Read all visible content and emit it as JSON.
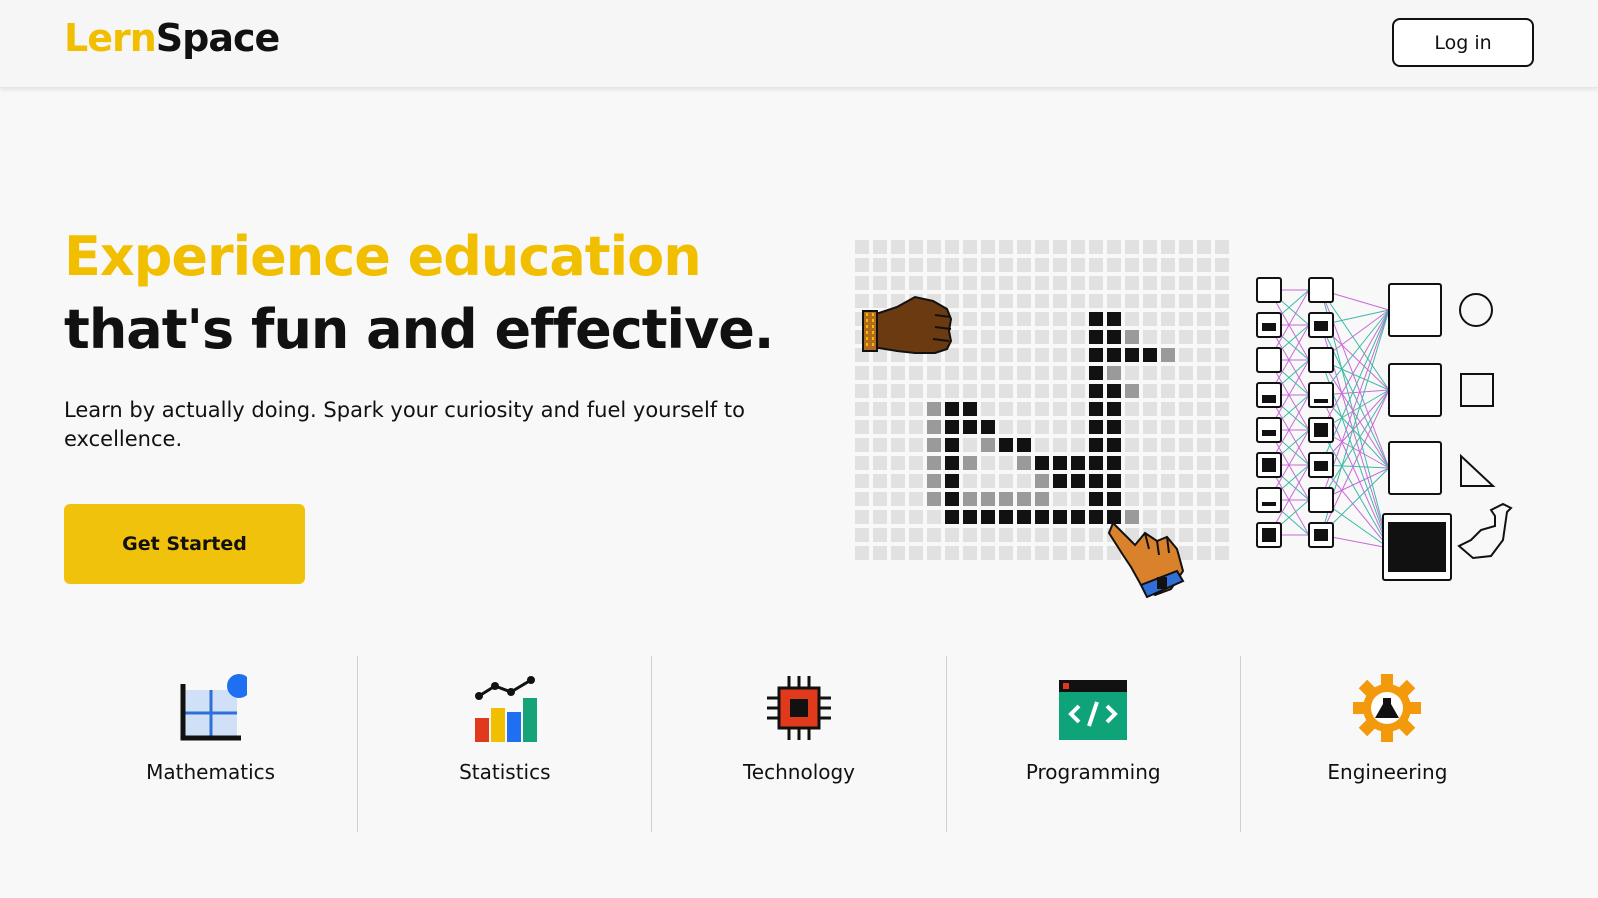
{
  "header": {
    "logo_part1": "Lern",
    "logo_part2": "Space",
    "login_label": "Log in"
  },
  "hero": {
    "title_accent": "Experience education",
    "title_rest": " that's fun and effective.",
    "subtitle": "Learn by actually doing. Spark your curiosity and fuel yourself to excellence.",
    "cta_label": "Get Started"
  },
  "categories": [
    {
      "label": "Mathematics",
      "icon": "math-grid-icon"
    },
    {
      "label": "Statistics",
      "icon": "bar-chart-icon"
    },
    {
      "label": "Technology",
      "icon": "chip-icon"
    },
    {
      "label": "Programming",
      "icon": "code-window-icon"
    },
    {
      "label": "Engineering",
      "icon": "gear-flask-icon"
    }
  ],
  "colors": {
    "accent": "#f1bf00",
    "button": "#f1c20c",
    "text": "#111111",
    "background": "#f8f8f8"
  }
}
